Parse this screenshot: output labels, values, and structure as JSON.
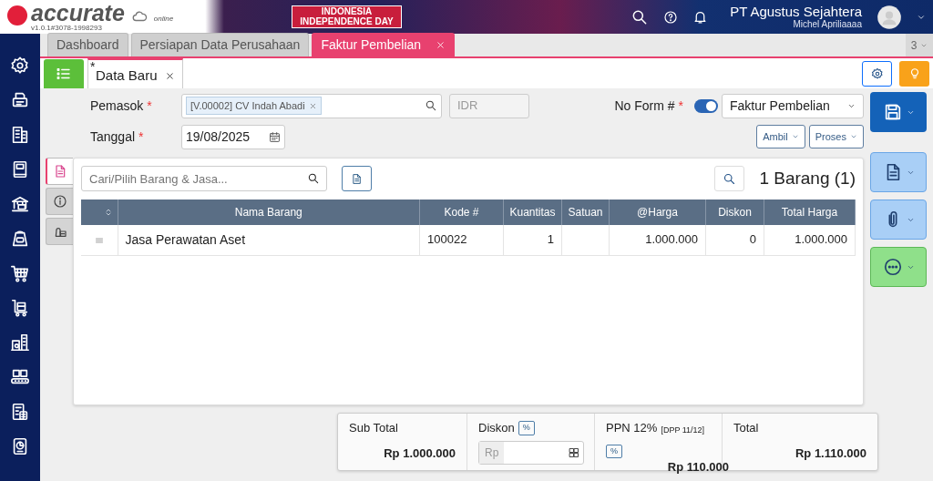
{
  "header": {
    "logo": "accurate",
    "logo_sub": "online",
    "version": "v1.0.1#3078-1998293",
    "banner": [
      "INDONESIA",
      "INDEPENDENCE DAY"
    ],
    "company": "PT Agustus Sejahtera",
    "user": "Michel Apriliaaaa"
  },
  "tabs": [
    {
      "label": "Dashboard",
      "selected": false,
      "closable": false
    },
    {
      "label": "Persiapan Data Perusahaan",
      "selected": false,
      "closable": false
    },
    {
      "label": "Faktur Pembelian",
      "selected": true,
      "closable": true
    }
  ],
  "tab_count": "3",
  "subtabs": [
    {
      "label": "Data Baru",
      "marker": "*",
      "selected": true
    }
  ],
  "form": {
    "supplier": {
      "label": "Pemasok",
      "required_mark": "*",
      "value": "[V.00002] CV Indah Abadi"
    },
    "currency": {
      "value": "IDR"
    },
    "form_no": {
      "label": "No Form #",
      "required_mark": "*",
      "auto": true,
      "value": "Faktur Pembelian"
    },
    "date": {
      "label": "Tanggal",
      "required_mark": "*",
      "value": "19/08/2025"
    },
    "buttons": [
      "Ambil",
      "Proses"
    ]
  },
  "side_tabs": [
    {
      "kind": "document",
      "selected": true
    },
    {
      "kind": "info",
      "selected": false
    },
    {
      "kind": "money",
      "selected": false
    }
  ],
  "items": {
    "search_placeholder": "Cari/Pilih Barang & Jasa...",
    "count": "1 Barang (1)",
    "columns": [
      "Nama Barang",
      "Kode #",
      "Kuantitas",
      "Satuan",
      "@Harga",
      "Diskon",
      "Total Harga"
    ],
    "rows": [
      [
        "Jasa Perawatan Aset",
        "100022",
        "1",
        "",
        "1.000.000",
        "0",
        "1.000.000"
      ]
    ]
  },
  "summary": {
    "subtotal": {
      "label": "Sub Total",
      "value": "Rp 1.000.000"
    },
    "discount": {
      "label": "Diskon",
      "unit": "%",
      "prefix": "Rp"
    },
    "tax": {
      "label": "PPN 12%",
      "note": "[DPP 11/12]",
      "unit": "%",
      "value": "Rp 110.000"
    },
    "total": {
      "label": "Total",
      "value": "Rp 1.110.000"
    }
  }
}
